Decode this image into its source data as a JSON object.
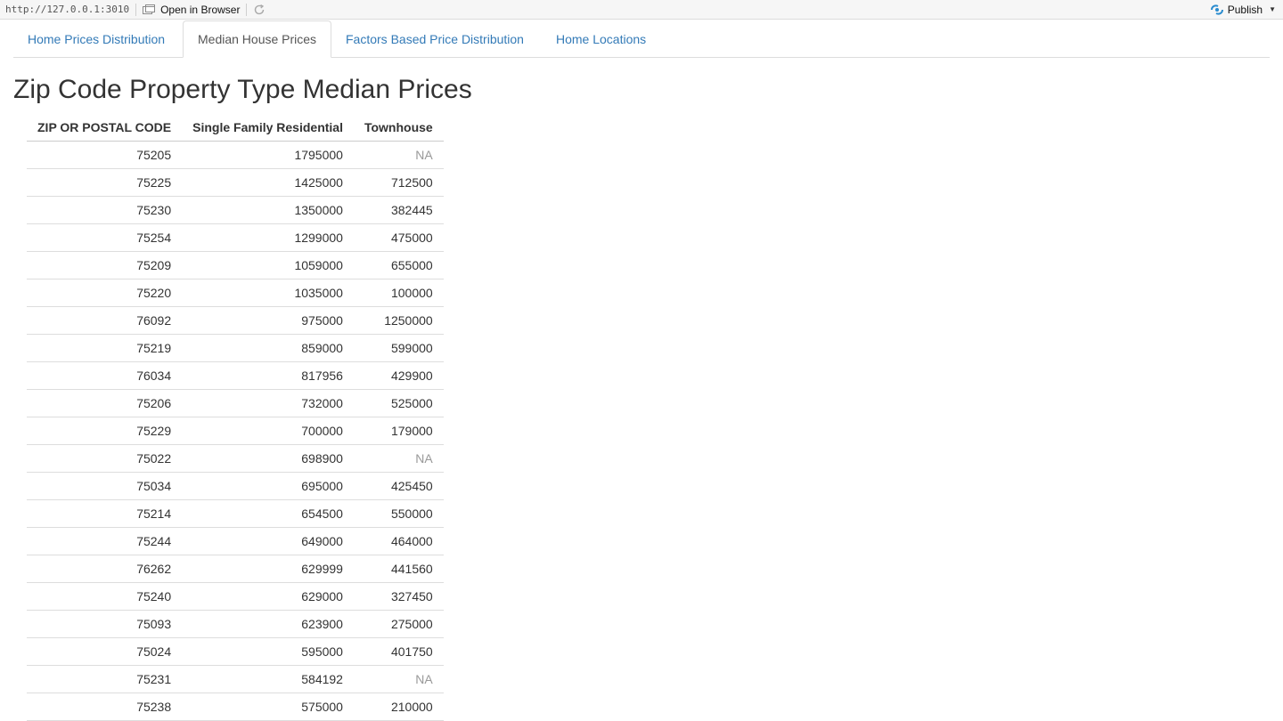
{
  "toolbar": {
    "url": "http://127.0.0.1:3010",
    "open_in_browser": "Open in Browser",
    "publish": "Publish"
  },
  "tabs": [
    {
      "label": "Home Prices Distribution",
      "active": false
    },
    {
      "label": "Median House Prices",
      "active": true
    },
    {
      "label": "Factors Based Price Distribution",
      "active": false
    },
    {
      "label": "Home Locations",
      "active": false
    }
  ],
  "page": {
    "title": "Zip Code Property Type Median Prices"
  },
  "table": {
    "headers": [
      "ZIP OR POSTAL CODE",
      "Single Family Residential",
      "Townhouse"
    ],
    "rows": [
      [
        "75205",
        "1795000",
        "NA"
      ],
      [
        "75225",
        "1425000",
        "712500"
      ],
      [
        "75230",
        "1350000",
        "382445"
      ],
      [
        "75254",
        "1299000",
        "475000"
      ],
      [
        "75209",
        "1059000",
        "655000"
      ],
      [
        "75220",
        "1035000",
        "100000"
      ],
      [
        "76092",
        "975000",
        "1250000"
      ],
      [
        "75219",
        "859000",
        "599000"
      ],
      [
        "76034",
        "817956",
        "429900"
      ],
      [
        "75206",
        "732000",
        "525000"
      ],
      [
        "75229",
        "700000",
        "179000"
      ],
      [
        "75022",
        "698900",
        "NA"
      ],
      [
        "75034",
        "695000",
        "425450"
      ],
      [
        "75214",
        "654500",
        "550000"
      ],
      [
        "75244",
        "649000",
        "464000"
      ],
      [
        "76262",
        "629999",
        "441560"
      ],
      [
        "75240",
        "629000",
        "327450"
      ],
      [
        "75093",
        "623900",
        "275000"
      ],
      [
        "75024",
        "595000",
        "401750"
      ],
      [
        "75231",
        "584192",
        "NA"
      ],
      [
        "75238",
        "575000",
        "210000"
      ]
    ]
  }
}
